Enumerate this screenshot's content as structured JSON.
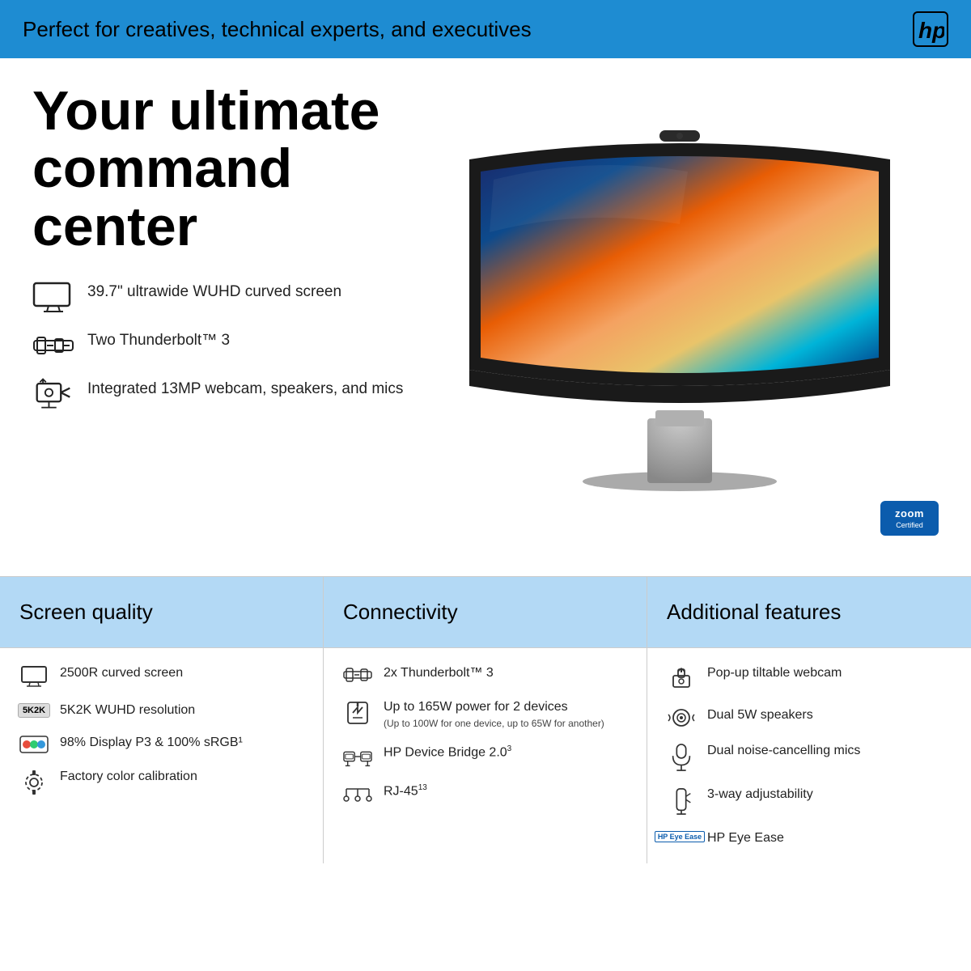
{
  "banner": {
    "text": "Perfect for creatives, technical experts, and executives",
    "logo": "hp"
  },
  "hero": {
    "title": "Your ultimate command center",
    "features": [
      {
        "icon": "monitor-icon",
        "text": "39.7\" ultrawide WUHD curved screen"
      },
      {
        "icon": "thunderbolt-icon",
        "text": "Two Thunderbolt™ 3"
      },
      {
        "icon": "webcam-icon",
        "text": "Integrated 13MP webcam, speakers, and mics"
      }
    ]
  },
  "zoom_badge": {
    "zoom": "zoom",
    "certified": "Certified"
  },
  "columns": [
    {
      "header": "Screen quality",
      "items": [
        {
          "icon": "monitor-icon",
          "text": "2500R curved screen"
        },
        {
          "icon": "5k2k-icon",
          "text": "5K2K WUHD resolution"
        },
        {
          "icon": "color-icon",
          "text": "98% Display P3 & 100% sRGB¹"
        },
        {
          "icon": "calibration-icon",
          "text": "Factory color calibration"
        }
      ]
    },
    {
      "header": "Connectivity",
      "items": [
        {
          "icon": "thunderbolt-icon",
          "text": "2x Thunderbolt™ 3",
          "sub": ""
        },
        {
          "icon": "power-icon",
          "text": "Up to 165W power for 2 devices",
          "sub": "(Up to 100W for one device, up to 65W for another)"
        },
        {
          "icon": "bridge-icon",
          "text": "HP Device Bridge 2.0³",
          "sub": ""
        },
        {
          "icon": "rj45-icon",
          "text": "RJ-45¹³",
          "sub": ""
        }
      ]
    },
    {
      "header": "Additional features",
      "items": [
        {
          "icon": "popup-webcam-icon",
          "text": "Pop-up tiltable webcam"
        },
        {
          "icon": "speaker-icon",
          "text": "Dual 5W speakers"
        },
        {
          "icon": "mic-icon",
          "text": "Dual noise-cancelling mics"
        },
        {
          "icon": "adjust-icon",
          "text": "3-way adjustability"
        },
        {
          "icon": "eyeease-icon",
          "text": "HP Eye Ease",
          "eyeease": true
        }
      ]
    }
  ]
}
